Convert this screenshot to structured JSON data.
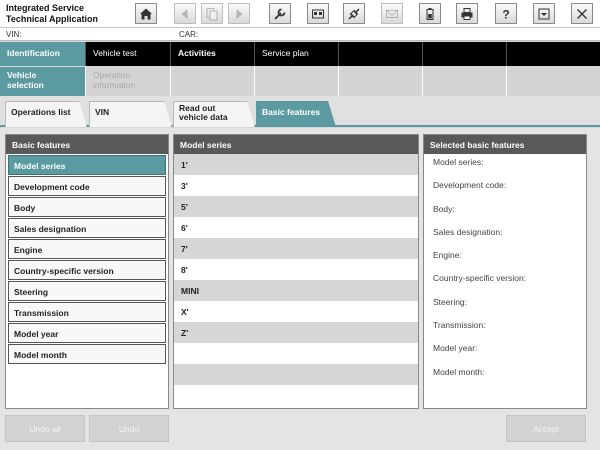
{
  "app": {
    "title_line1": "Integrated Service",
    "title_line2": "Technical Application"
  },
  "toolbar": {
    "icons": [
      "home-icon",
      "arrow-left-icon",
      "copy-icon",
      "arrow-right-icon",
      "wrench-icon",
      "panel-icon",
      "connection-icon",
      "mail-icon",
      "battery-icon",
      "printer-icon",
      "help-icon",
      "minimize-icon",
      "close-icon"
    ]
  },
  "vehicle": {
    "vin_label": "VIN:",
    "car_label": "CAR:"
  },
  "main_nav": {
    "items": [
      {
        "label": "Identification",
        "active": true
      },
      {
        "label": "Vehicle test",
        "active": false
      },
      {
        "label": "Activities",
        "active": false
      },
      {
        "label": "Service plan",
        "active": false
      },
      {
        "label": "",
        "active": false
      },
      {
        "label": "",
        "active": false
      },
      {
        "label": "",
        "active": false
      }
    ]
  },
  "sub_nav": {
    "items": [
      {
        "line1": "Vehicle",
        "line2": "selection",
        "active": true
      },
      {
        "line1": "Operation",
        "line2": "information",
        "active": false
      }
    ]
  },
  "tabs": [
    {
      "label": "Operations list",
      "active": false
    },
    {
      "label": "VIN",
      "active": false
    },
    {
      "line1": "Read out",
      "line2": "vehicle data",
      "active": false
    },
    {
      "label": "Basic features",
      "active": true
    }
  ],
  "basic_features": {
    "header": "Basic features",
    "items": [
      {
        "label": "Model series",
        "selected": true
      },
      {
        "label": "Development code",
        "selected": false
      },
      {
        "label": "Body",
        "selected": false
      },
      {
        "label": "Sales designation",
        "selected": false
      },
      {
        "label": "Engine",
        "selected": false
      },
      {
        "label": "Country-specific version",
        "selected": false
      },
      {
        "label": "Steering",
        "selected": false
      },
      {
        "label": "Transmission",
        "selected": false
      },
      {
        "label": "Model year",
        "selected": false
      },
      {
        "label": "Model month",
        "selected": false
      }
    ]
  },
  "model_series": {
    "header": "Model series",
    "items": [
      "1'",
      "3'",
      "5'",
      "6'",
      "7'",
      "8'",
      "MINI",
      "X'",
      "Z'",
      "",
      "",
      ""
    ]
  },
  "selected_features": {
    "header": "Selected basic features",
    "items": [
      "Model series:",
      "Development code:",
      "Body:",
      "Sales designation:",
      "Engine:",
      "Country-specific version:",
      "Steering:",
      "Transmission:",
      "Model year:",
      "Model month:"
    ]
  },
  "buttons": {
    "undo_all": "Undo all",
    "undo": "Undo",
    "accept": "Accept"
  }
}
